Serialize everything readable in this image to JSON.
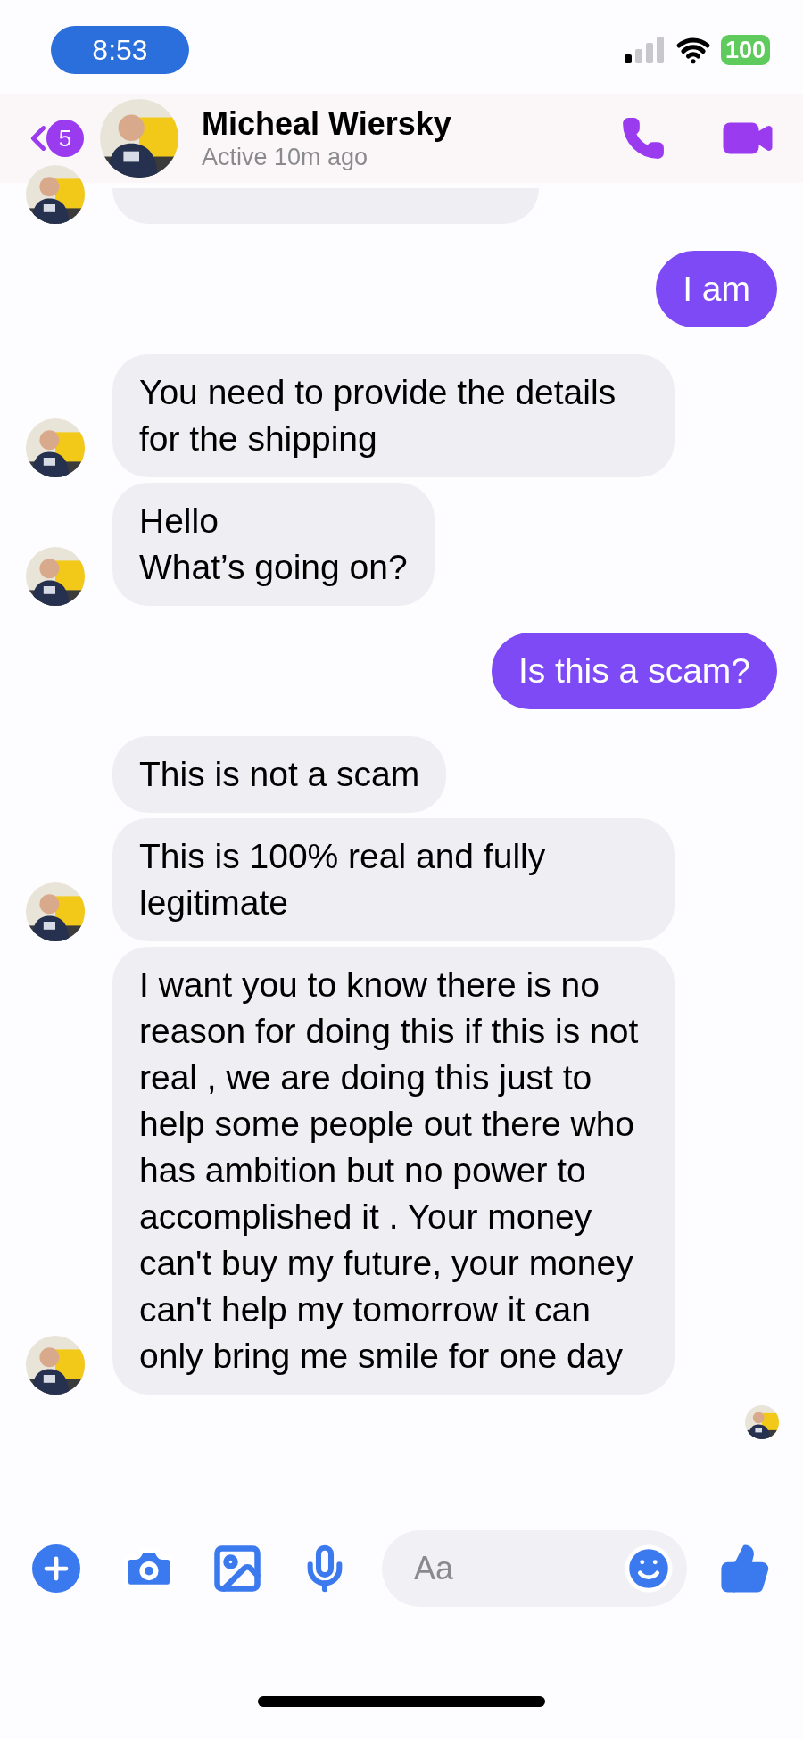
{
  "status_bar": {
    "time": "8:53",
    "battery": "100"
  },
  "header": {
    "unread_count": "5",
    "name": "Micheal Wiersky",
    "status": "Active 10m ago"
  },
  "messages": [
    {
      "kind": "partial",
      "avatar": true
    },
    {
      "kind": "outgoing",
      "text": "I am"
    },
    {
      "kind": "incoming",
      "text": "You need to provide the details for the shipping",
      "avatar": true
    },
    {
      "kind": "incoming",
      "text": "Hello\nWhat’s going on?",
      "avatar": true
    },
    {
      "kind": "outgoing",
      "text": "Is this a scam?"
    },
    {
      "kind": "incoming",
      "text": "This is not a scam",
      "avatar": false
    },
    {
      "kind": "incoming",
      "text": "This is 100% real and fully legitimate",
      "avatar": true
    },
    {
      "kind": "incoming",
      "text": "I want you to know there is no reason for doing this if this is not real , we are doing this just to help some people out there who has ambition but no power to accomplished it . Your money can't buy my future, your money can't help my tomorrow it can only bring me smile for one day",
      "avatar": true
    }
  ],
  "composer": {
    "placeholder": "Aa"
  }
}
